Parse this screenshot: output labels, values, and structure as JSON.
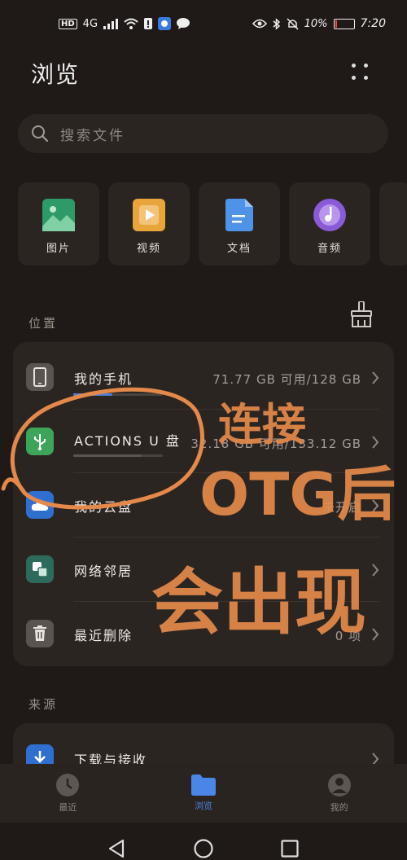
{
  "status_bar": {
    "network": "4G",
    "battery_text": "10%",
    "battery_level": 0.1,
    "time": "7:20"
  },
  "header": {
    "title": "浏览"
  },
  "search": {
    "placeholder": "搜索文件"
  },
  "categories": [
    {
      "label": "图片",
      "icon": "image-icon",
      "color": "#2e9a67"
    },
    {
      "label": "视频",
      "icon": "video-icon",
      "color": "#e8a53a"
    },
    {
      "label": "文档",
      "icon": "document-icon",
      "color": "#4f93e8"
    },
    {
      "label": "音频",
      "icon": "audio-icon",
      "color": "#8a5bd6"
    }
  ],
  "location": {
    "section_label": "位置",
    "items": [
      {
        "name": "我的手机",
        "info": "71.77 GB 可用/128 GB",
        "icon": "phone-icon",
        "usage": 0.44
      },
      {
        "name": "ACTIONS U 盘",
        "info": "32.18 GB 可用/133.12 GB",
        "icon": "usb-icon",
        "usage": 0.76
      },
      {
        "name": "我的云盘",
        "info": "未开启",
        "icon": "cloud-icon"
      },
      {
        "name": "网络邻居",
        "info": "",
        "icon": "network-neighbor-icon"
      },
      {
        "name": "最近删除",
        "info": "0 项",
        "icon": "trash-icon"
      }
    ]
  },
  "source": {
    "section_label": "来源",
    "items": [
      {
        "name": "下载与接收",
        "icon": "download-icon"
      }
    ]
  },
  "bottom_nav": [
    {
      "label": "最近",
      "icon": "clock-icon",
      "active": false
    },
    {
      "label": "浏览",
      "icon": "folder-icon",
      "active": true
    },
    {
      "label": "我的",
      "icon": "profile-icon",
      "active": false
    }
  ],
  "annotation": {
    "text": [
      "连接",
      "OTG后",
      "会出现"
    ],
    "color": "#e5894a"
  }
}
